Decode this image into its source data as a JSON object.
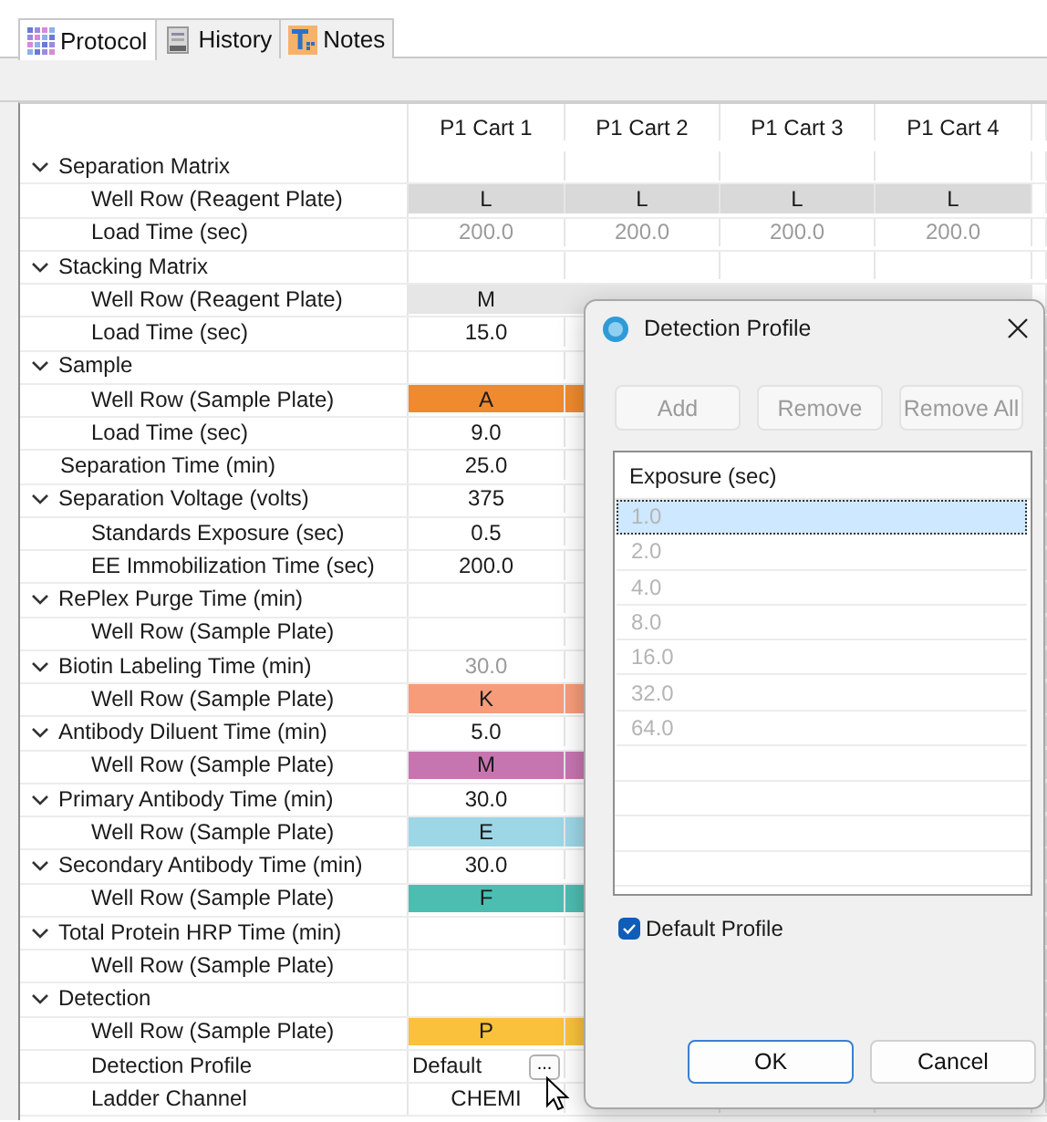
{
  "tabs": [
    {
      "label": "Protocol",
      "kind": "grid",
      "selected": true
    },
    {
      "label": "History",
      "kind": "document",
      "selected": false
    },
    {
      "label": "Notes",
      "kind": "text",
      "selected": false
    }
  ],
  "table": {
    "columns": [
      "P1 Cart 1",
      "P1 Cart 2",
      "P1 Cart 3",
      "P1 Cart 4"
    ],
    "rows": [
      {
        "label": "Separation Matrix",
        "expanded": true,
        "disabled": false,
        "children": [
          {
            "label": "Well Row (Reagent Plate)",
            "disabled": false,
            "color": "#d9d9d9",
            "values": [
              "L",
              "L",
              "L",
              "L"
            ]
          },
          {
            "label": "Load Time (sec)",
            "disabled": true,
            "values": [
              "200.0",
              "200.0",
              "200.0",
              "200.0"
            ]
          }
        ]
      },
      {
        "label": "Stacking Matrix",
        "expanded": true,
        "disabled": false,
        "children": [
          {
            "label": "Well Row (Reagent Plate)",
            "disabled": false,
            "color": "#e6e6e6",
            "values": [
              "M"
            ]
          },
          {
            "label": "Load Time (sec)",
            "disabled": false,
            "values": [
              "15.0"
            ]
          }
        ]
      },
      {
        "label": "Sample",
        "expanded": true,
        "disabled": false,
        "children": [
          {
            "label": "Well Row (Sample Plate)",
            "disabled": false,
            "color": "#ef8a2e",
            "values": [
              "A"
            ]
          },
          {
            "label": "Load Time (sec)",
            "disabled": false,
            "values": [
              "9.0"
            ]
          }
        ]
      },
      {
        "label": "Separation Time (min)",
        "disabled": false,
        "values": [
          "25.0"
        ]
      },
      {
        "label": "Separation Voltage (volts)",
        "expanded": true,
        "disabled": false,
        "values": [
          "375"
        ],
        "children": [
          {
            "label": "Standards Exposure (sec)",
            "disabled": false,
            "values": [
              "0.5"
            ]
          },
          {
            "label": "EE Immobilization Time (sec)",
            "disabled": false,
            "values": [
              "200.0"
            ]
          }
        ]
      },
      {
        "label": "RePlex Purge Time (min)",
        "expanded": true,
        "disabled": false,
        "children": [
          {
            "label": "Well Row (Sample Plate)",
            "disabled": false
          }
        ]
      },
      {
        "label": "Biotin Labeling Time (min)",
        "expanded": true,
        "disabled": true,
        "values": [
          "30.0"
        ],
        "children": [
          {
            "label": "Well Row (Sample Plate)",
            "disabled": false,
            "color": "#f79c7a",
            "values": [
              "K"
            ]
          }
        ]
      },
      {
        "label": "Antibody Diluent Time (min)",
        "expanded": true,
        "disabled": false,
        "values": [
          "5.0"
        ],
        "children": [
          {
            "label": "Well Row (Sample Plate)",
            "disabled": false,
            "color": "#c775b1",
            "values": [
              "M"
            ]
          }
        ]
      },
      {
        "label": "Primary Antibody Time (min)",
        "expanded": true,
        "disabled": false,
        "values": [
          "30.0"
        ],
        "children": [
          {
            "label": "Well Row (Sample Plate)",
            "disabled": false,
            "color": "#9dd7e6",
            "values": [
              "E"
            ]
          }
        ]
      },
      {
        "label": "Secondary Antibody Time (min)",
        "expanded": true,
        "disabled": false,
        "values": [
          "30.0"
        ],
        "children": [
          {
            "label": "Well Row (Sample Plate)",
            "disabled": false,
            "color": "#4dbdb1",
            "values": [
              "F"
            ]
          }
        ]
      },
      {
        "label": "Total Protein HRP Time (min)",
        "expanded": true,
        "disabled": false,
        "children": [
          {
            "label": "Well Row (Sample Plate)",
            "disabled": false
          }
        ]
      },
      {
        "label": "Detection",
        "expanded": true,
        "disabled": false,
        "children": [
          {
            "label": "Well Row (Sample Plate)",
            "disabled": false,
            "color": "#f9c13c",
            "values": [
              "P"
            ]
          },
          {
            "label": "Detection Profile",
            "disabled": false,
            "values": [
              "Default"
            ],
            "button": "..."
          },
          {
            "label": "Ladder Channel",
            "disabled": false,
            "values": [
              "CHEMI"
            ]
          }
        ]
      }
    ]
  },
  "dialog": {
    "title": "Detection Profile",
    "buttons": [
      {
        "label": "Add",
        "disabled": true
      },
      {
        "label": "Remove",
        "disabled": true
      },
      {
        "label": "Remove All",
        "disabled": true
      }
    ],
    "list": {
      "header": "Exposure (sec)",
      "items": [
        {
          "text": "1.0",
          "selected": true
        },
        {
          "text": "2.0",
          "selected": false
        },
        {
          "text": "4.0",
          "selected": false
        },
        {
          "text": "8.0",
          "selected": false
        },
        {
          "text": "16.0",
          "selected": false
        },
        {
          "text": "32.0",
          "selected": false
        },
        {
          "text": "64.0",
          "selected": false
        }
      ]
    },
    "checkbox": {
      "label": "Default Profile",
      "checked": true
    },
    "actions": [
      {
        "label": "OK",
        "default": true
      },
      {
        "label": "Cancel",
        "default": false
      }
    ]
  }
}
